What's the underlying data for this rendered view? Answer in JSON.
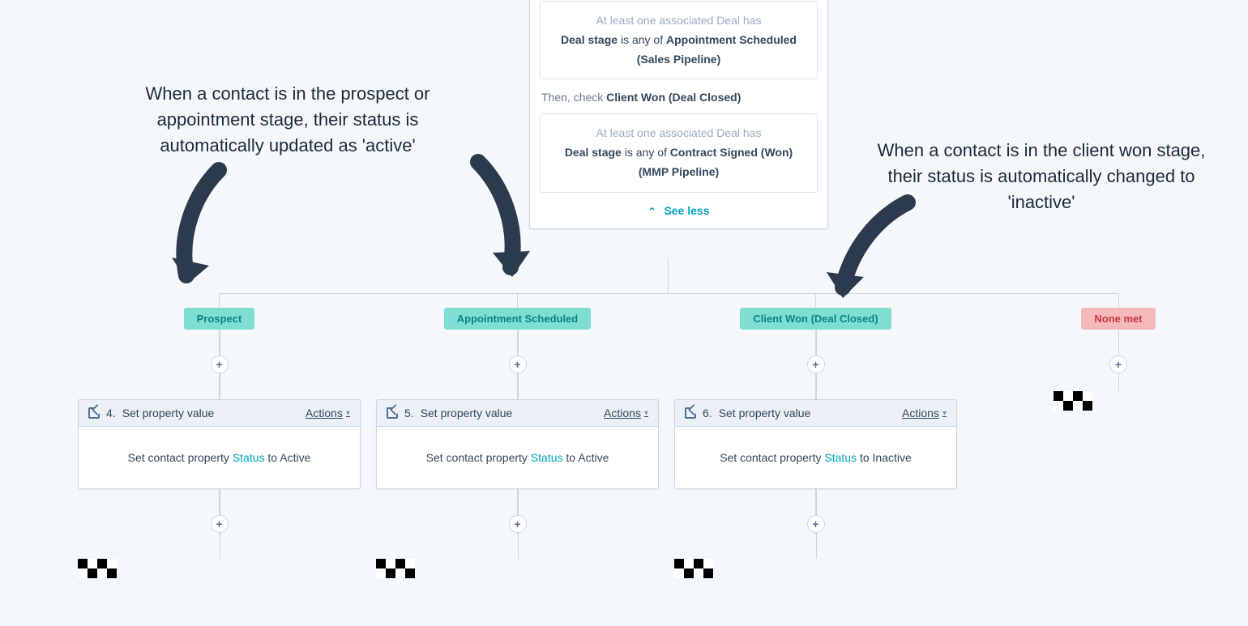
{
  "condition_card": {
    "cond1": {
      "prefix": "At least one associated Deal has",
      "subject": "Deal stage",
      "op": "is any of",
      "value": "Appointment Scheduled (Sales Pipeline)"
    },
    "then_prefix": "Then, check",
    "then_value": "Client Won (Deal Closed)",
    "cond2": {
      "prefix": "At least one associated Deal has",
      "subject": "Deal stage",
      "op": "is any of",
      "value": "Contract Signed (Won) (MMP Pipeline)"
    },
    "see_less": "See less"
  },
  "branches": [
    {
      "badge": "Prospect",
      "action": {
        "number": "4.",
        "title": "Set property value",
        "actions_label": "Actions",
        "body_prefix": "Set contact property",
        "property": "Status",
        "to": "to",
        "value": "Active"
      }
    },
    {
      "badge": "Appointment Scheduled",
      "action": {
        "number": "5.",
        "title": "Set property value",
        "actions_label": "Actions",
        "body_prefix": "Set contact property",
        "property": "Status",
        "to": "to",
        "value": "Active"
      }
    },
    {
      "badge": "Client Won (Deal Closed)",
      "action": {
        "number": "6.",
        "title": "Set property value",
        "actions_label": "Actions",
        "body_prefix": "Set contact property",
        "property": "Status",
        "to": "to",
        "value": "Inactive"
      }
    }
  ],
  "none_met": "None met",
  "annotations": {
    "left": "When a contact is in the prospect or appointment stage, their status is automatically updated as 'active'",
    "right": "When a contact is in the client won stage, their status is automatically changed to 'inactive'"
  }
}
